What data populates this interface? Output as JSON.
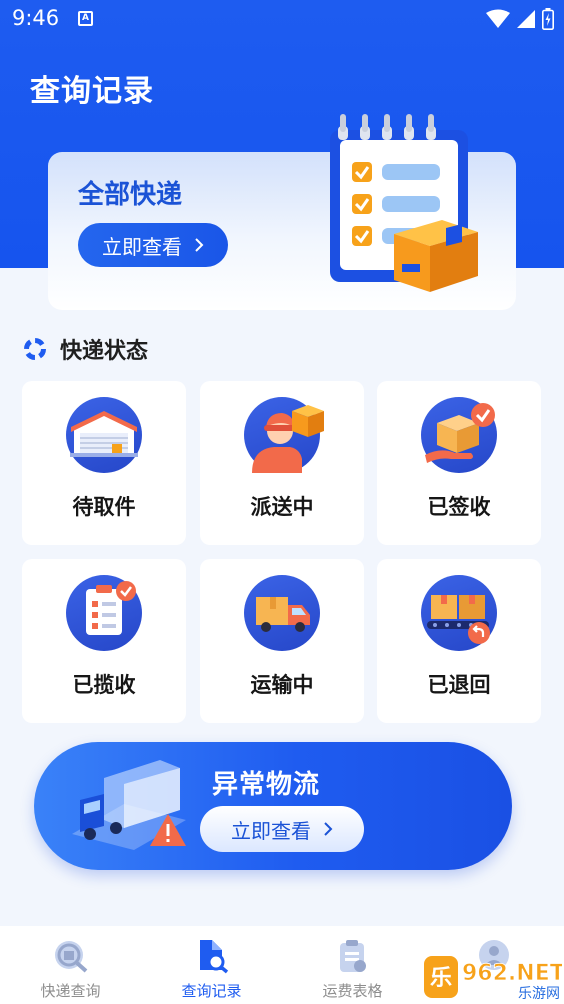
{
  "status_bar": {
    "time": "9:46",
    "notification_glyph": "A"
  },
  "header": {
    "title": "查询记录"
  },
  "all_express": {
    "title": "全部快递",
    "button_label": "立即查看"
  },
  "status_section": {
    "title": "快递状态",
    "items": [
      {
        "label": "待取件",
        "icon": "warehouse-icon"
      },
      {
        "label": "派送中",
        "icon": "courier-delivering-icon"
      },
      {
        "label": "已签收",
        "icon": "package-signed-icon"
      },
      {
        "label": "已揽收",
        "icon": "clipboard-check-icon"
      },
      {
        "label": "运输中",
        "icon": "truck-icon"
      },
      {
        "label": "已退回",
        "icon": "conveyor-return-icon"
      }
    ]
  },
  "abnormal": {
    "title": "异常物流",
    "button_label": "立即查看"
  },
  "tabs": [
    {
      "label": "快递查询",
      "icon": "express-search-icon",
      "active": false
    },
    {
      "label": "查询记录",
      "icon": "record-search-icon",
      "active": true
    },
    {
      "label": "运费表格",
      "icon": "freight-table-icon",
      "active": false
    },
    {
      "label": "",
      "icon": "profile-icon",
      "active": false
    }
  ],
  "watermark": {
    "text": "962.NET",
    "sub": "乐游网"
  },
  "colors": {
    "primary": "#1f5cf0",
    "background": "#f2f6fd",
    "text": "#161616",
    "inactive": "#8e8e8e",
    "accent_orange": "#f7a21a",
    "alert_red": "#e8453c"
  }
}
